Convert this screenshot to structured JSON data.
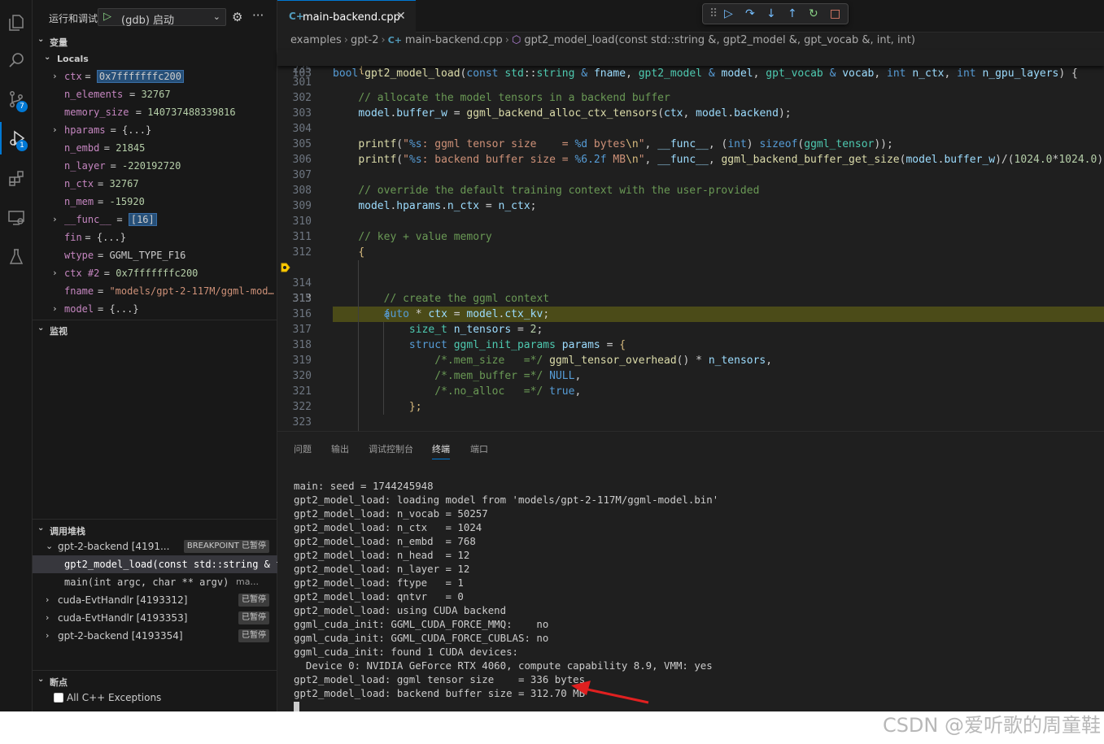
{
  "run": {
    "title": "运行和调试",
    "config": "(gdb) 启动"
  },
  "sections": {
    "variables": "变量",
    "locals": "Locals",
    "watch": "监视",
    "callstack": "调用堆栈",
    "breakpoints": "断点"
  },
  "activity_badges": {
    "scm": "7",
    "debug": "1"
  },
  "variables": [
    {
      "chev": "›",
      "name": "ctx",
      "value": "0x7fffffffc200",
      "vtype": "hl"
    },
    {
      "chev": "",
      "name": "n_elements",
      "value": "32767",
      "vtype": "num"
    },
    {
      "chev": "",
      "name": "memory_size",
      "value": "140737488339816",
      "vtype": "num"
    },
    {
      "chev": "›",
      "name": "hparams",
      "value": "{...}",
      "vtype": "txt"
    },
    {
      "chev": "",
      "name": "n_embd",
      "value": "21845",
      "vtype": "num"
    },
    {
      "chev": "",
      "name": "n_layer",
      "value": "-220192720",
      "vtype": "num"
    },
    {
      "chev": "",
      "name": "n_ctx",
      "value": "32767",
      "vtype": "num"
    },
    {
      "chev": "",
      "name": "n_mem",
      "value": "-15920",
      "vtype": "num"
    },
    {
      "chev": "›",
      "name": "__func__",
      "value": "[16]",
      "vtype": "hl"
    },
    {
      "chev": "",
      "name": "fin",
      "value": "{...}",
      "vtype": "txt"
    },
    {
      "chev": "",
      "name": "wtype",
      "value": "GGML_TYPE_F16",
      "vtype": "txt"
    },
    {
      "chev": "›",
      "name": "ctx #2",
      "value": "0x7fffffffc200",
      "vtype": "num"
    },
    {
      "chev": "",
      "name": "fname",
      "value": "\"models/gpt-2-117M/ggml-mod…",
      "vtype": "str"
    },
    {
      "chev": "›",
      "name": "model",
      "value": "{...}",
      "vtype": "txt"
    }
  ],
  "callstack": {
    "thread_main": {
      "label": "gpt-2-backend [4191...",
      "badge": "BREAKPOINT 已暂停"
    },
    "frames": [
      {
        "label": "gpt2_model_load(const std::string & f"
      },
      {
        "label": "main(int argc, char ** argv)",
        "suffix": "ma..."
      }
    ],
    "threads": [
      {
        "label": "cuda-EvtHandlr [4193312]",
        "badge": "已暂停"
      },
      {
        "label": "cuda-EvtHandlr [4193353]",
        "badge": "已暂停"
      },
      {
        "label": "gpt-2-backend [4193354]",
        "badge": "已暂停"
      }
    ]
  },
  "breakpoints": [
    {
      "label": "All C++ Exceptions",
      "checked": false
    }
  ],
  "editor": {
    "tab": "main-backend.cpp",
    "breadcrumbs": [
      "examples",
      "gpt-2",
      "main-backend.cpp",
      "gpt2_model_load(const std::string &, gpt2_model &, gpt_vocab &, int, int)"
    ],
    "current_line": "313"
  },
  "debug_toolbar": [
    "continue-icon",
    "step-over-icon",
    "step-into-icon",
    "step-out-icon",
    "restart-icon",
    "stop-icon"
  ],
  "panel": {
    "tabs": [
      "问题",
      "输出",
      "调试控制台",
      "终端",
      "端口"
    ],
    "active": "终端"
  },
  "terminal_lines": [
    "main: seed = 1744245948",
    "gpt2_model_load: loading model from 'models/gpt-2-117M/ggml-model.bin'",
    "gpt2_model_load: n_vocab = 50257",
    "gpt2_model_load: n_ctx   = 1024",
    "gpt2_model_load: n_embd  = 768",
    "gpt2_model_load: n_head  = 12",
    "gpt2_model_load: n_layer = 12",
    "gpt2_model_load: ftype   = 1",
    "gpt2_model_load: qntvr   = 0",
    "gpt2_model_load: using CUDA backend",
    "ggml_cuda_init: GGML_CUDA_FORCE_MMQ:    no",
    "ggml_cuda_init: GGML_CUDA_FORCE_CUBLAS: no",
    "ggml_cuda_init: found 1 CUDA devices:",
    "  Device 0: NVIDIA GeForce RTX 4060, compute capability 8.9, VMM: yes",
    "gpt2_model_load: ggml tensor size    = 336 bytes",
    "gpt2_model_load: backend buffer size = 312.70 MB"
  ],
  "watermark": "CSDN @爱听歌的周童鞋"
}
